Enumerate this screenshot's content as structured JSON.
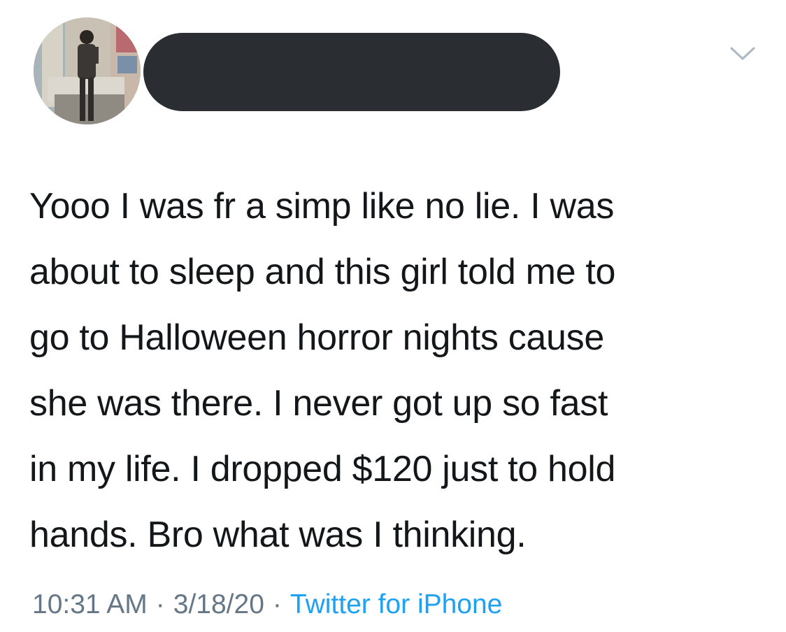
{
  "tweet": {
    "text": "Yooo I was fr a simp like no lie. I was\nabout to sleep and this girl told me to\ngo to Halloween horror nights cause\nshe was there. I never got up so fast\nin my life. I dropped $120 just to hold\nhands. Bro what was I thinking.",
    "time": "10:31 AM",
    "separator": "·",
    "date": "3/18/20",
    "source": "Twitter for iPhone"
  },
  "icons": {
    "menu": "chevron-down-icon",
    "avatar": "profile-photo"
  },
  "colors": {
    "text": "#14171a",
    "meta": "#657786",
    "link": "#1da1f2",
    "redaction": "#2a2d31"
  }
}
